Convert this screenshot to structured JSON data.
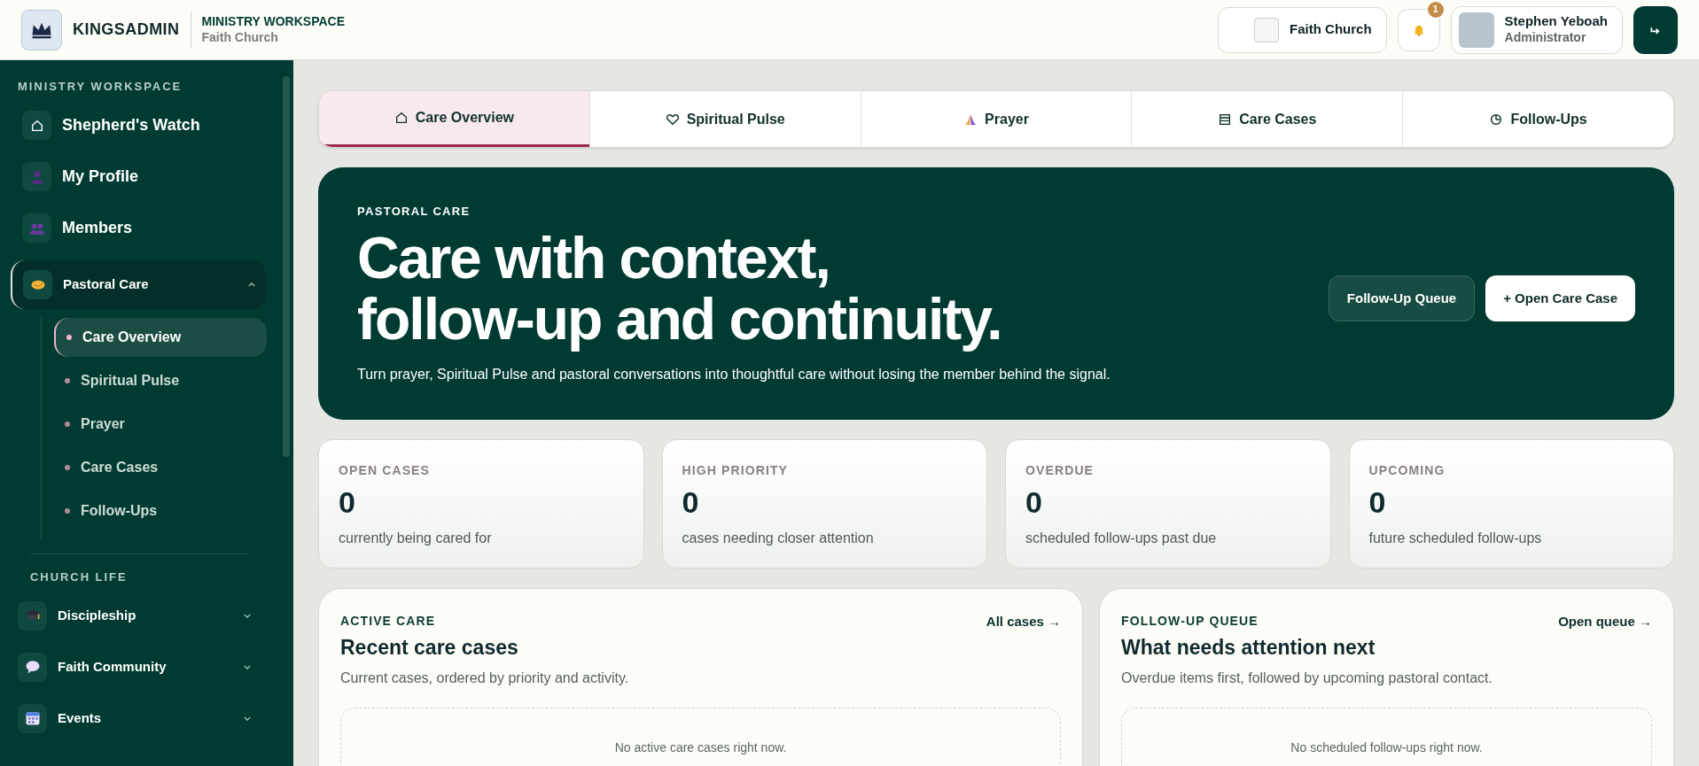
{
  "header": {
    "brand": "KINGSADMIN",
    "workspace_title": "MINISTRY WORKSPACE",
    "workspace_subtitle": "Faith Church",
    "church_button": "Faith Church",
    "notification_count": "1",
    "user_name": "Stephen Yeboah",
    "user_role": "Administrator"
  },
  "sidebar": {
    "sections": [
      {
        "title": "MINISTRY WORKSPACE",
        "items": [
          {
            "label": "Shepherd's Watch",
            "kind": "link",
            "selected": false
          },
          {
            "label": "My Profile",
            "kind": "link",
            "selected": false
          },
          {
            "label": "Members",
            "kind": "link",
            "selected": false
          },
          {
            "label": "Pastoral Care",
            "kind": "group",
            "selected": true,
            "expanded": true,
            "children": [
              {
                "label": "Care Overview",
                "selected": true
              },
              {
                "label": "Spiritual Pulse",
                "selected": false
              },
              {
                "label": "Prayer",
                "selected": false
              },
              {
                "label": "Care Cases",
                "selected": false
              },
              {
                "label": "Follow-Ups",
                "selected": false
              }
            ]
          }
        ]
      },
      {
        "title": "CHURCH LIFE",
        "items": [
          {
            "label": "Discipleship",
            "kind": "group",
            "selected": false,
            "expanded": false
          },
          {
            "label": "Faith Community",
            "kind": "group",
            "selected": false,
            "expanded": false
          },
          {
            "label": "Events",
            "kind": "group",
            "selected": false,
            "expanded": false
          }
        ]
      }
    ]
  },
  "tabs": [
    {
      "label": "Care Overview",
      "selected": true
    },
    {
      "label": "Spiritual Pulse",
      "selected": false
    },
    {
      "label": "Prayer",
      "selected": false
    },
    {
      "label": "Care Cases",
      "selected": false
    },
    {
      "label": "Follow-Ups",
      "selected": false
    }
  ],
  "hero": {
    "eyebrow": "PASTORAL CARE",
    "title_lines": [
      "Care with context,",
      "follow-up and continuity."
    ],
    "description": "Turn prayer, Spiritual Pulse and pastoral conversations into thoughtful care without losing the member behind the signal.",
    "buttons": [
      {
        "label": "Follow-Up Queue",
        "kind": "secondary"
      },
      {
        "label": "+ Open Care Case",
        "kind": "primary"
      }
    ]
  },
  "stats": [
    {
      "label": "OPEN CASES",
      "value": "0",
      "caption": "currently being cared for"
    },
    {
      "label": "HIGH PRIORITY",
      "value": "0",
      "caption": "cases needing closer attention"
    },
    {
      "label": "OVERDUE",
      "value": "0",
      "caption": "scheduled follow-ups past due"
    },
    {
      "label": "UPCOMING",
      "value": "0",
      "caption": "future scheduled follow-ups"
    }
  ],
  "panels": [
    {
      "eyebrow": "ACTIVE CARE",
      "title": "Recent care cases",
      "description": "Current cases, ordered by priority and activity.",
      "link": "All cases →",
      "empty": "No active care cases right now."
    },
    {
      "eyebrow": "FOLLOW-UP QUEUE",
      "title": "What needs attention next",
      "description": "Overdue items first, followed by upcoming pastoral contact.",
      "link": "Open queue →",
      "empty": "No scheduled follow-ups right now."
    }
  ]
}
